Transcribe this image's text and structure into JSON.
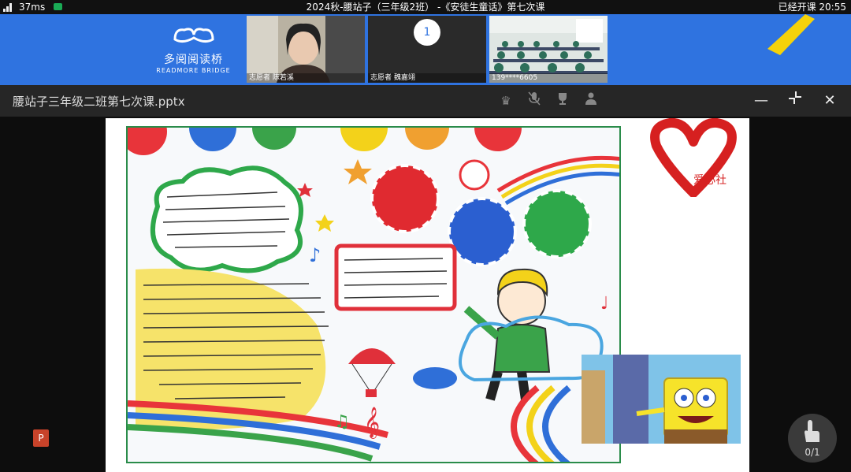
{
  "status": {
    "latency": "37ms",
    "title": "2024秋-腰站子（三年级2班） -《安徒生童话》第七次课",
    "elapsed": "已经开课 20:55"
  },
  "logo": {
    "name_cn": "多阅阅读桥",
    "name_en": "READMORE BRIDGE"
  },
  "participants": [
    {
      "label": "志愿者 陈若溪"
    },
    {
      "label": "志愿者 魏嘉翊",
      "badge": "1"
    },
    {
      "label": "139****6605"
    }
  ],
  "document": {
    "title": "腰站子三年级二班第七次课.pptx"
  },
  "slide": {
    "club_label": "爱心社",
    "file_icon": "P"
  },
  "hand_raise": {
    "count": "0/1"
  },
  "colors": {
    "banner": "#2f73e0",
    "accent_yellow": "#f5d20a",
    "heart_red": "#d62020"
  }
}
